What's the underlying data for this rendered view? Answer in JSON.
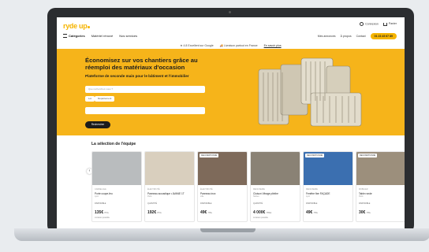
{
  "header": {
    "logo": "ryde up",
    "nav": [
      "Catégories",
      "Matériel rénové",
      "Nos services"
    ],
    "account": [
      "Connexion",
      "Panier"
    ],
    "right_links": [
      "Mes annonces",
      "À propos",
      "Contact"
    ],
    "phone": "01 23 45 67 89",
    "info": [
      "★ 4.8 Excellent sur Google",
      "🚚 Livraison partout en France",
      "En savoir plus"
    ]
  },
  "hero": {
    "title": "Économisez sur vos chantiers grâce au réemploi des matériaux d'occasion",
    "subtitle": "Plateforme de seconde main pour le bâtiment et l'immobilier",
    "field1_placeholder": "Que recherchez-vous ?",
    "chips": [
      "Lot",
      "Département"
    ],
    "field2_placeholder": "",
    "cta": "Rechercher"
  },
  "section": {
    "title": "La sélection de l'équipe",
    "prev": "‹",
    "next": "›"
  },
  "products": [
    {
      "badge": "",
      "category": "CARRELAGE",
      "name": "Porte coupe-feu",
      "location": "Lyon",
      "stock": "DISPONIBLE",
      "price": "135€",
      "unit": "HT/u",
      "ship": "Livraison possible",
      "img": "#b9bcbe"
    },
    {
      "badge": "",
      "category": "ÉLECTRICITÉ",
      "name": "Panneau acoustique • AVANE 1T",
      "location": "Paris",
      "stock": "QUANTITÉ",
      "price": "192€",
      "unit": "HT/u",
      "ship": "",
      "img": "#d9cfbe"
    },
    {
      "badge": "RECONDITIONNÉ",
      "category": "ÉLECTRICITÉ",
      "name": "Panneau inox",
      "location": "Lille",
      "stock": "DISPONIBLE",
      "price": "49€",
      "unit": "HT/u",
      "ship": "",
      "img": "#7e6a5a"
    },
    {
      "badge": "",
      "category": "MENUISERIE",
      "name": "Cloison Vitrage plinthe",
      "location": "Nantes",
      "stock": "QUANTITÉ",
      "price": "4 000€",
      "unit": "HT/lot",
      "ship": "Livraison possible",
      "img": "#8a8275"
    },
    {
      "badge": "RECONDITIONNÉ",
      "category": "MENUISERIE",
      "name": "Fenêtre fixe FAÇADE",
      "location": "Lyon",
      "stock": "DISPONIBLE",
      "price": "49€",
      "unit": "HT/u",
      "ship": "",
      "img": "#3b6fb0"
    },
    {
      "badge": "RECONDITIONNÉ",
      "category": "MOBILIER",
      "name": "Table ronde",
      "location": "Paris",
      "stock": "DISPONIBLE",
      "price": "30€",
      "unit": "HT/u",
      "ship": "",
      "img": "#9c8f7c"
    }
  ],
  "colors": {
    "brand": "#f6b41a",
    "dark": "#1c1c1c"
  }
}
